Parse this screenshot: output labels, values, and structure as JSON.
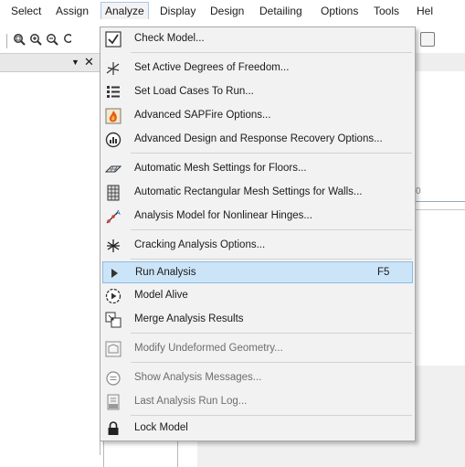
{
  "menubar": {
    "items": [
      {
        "label": "Select"
      },
      {
        "label": "Assign"
      },
      {
        "label": "Analyze"
      },
      {
        "label": "Display"
      },
      {
        "label": "Design"
      },
      {
        "label": "Detailing"
      },
      {
        "label": "Options"
      },
      {
        "label": "Tools"
      },
      {
        "label": "Hel"
      }
    ],
    "active": "Analyze"
  },
  "toolbar": {
    "icons": [
      "zoom-window-icon",
      "zoom-in-icon",
      "zoom-out-icon",
      "zoom-extents-icon"
    ]
  },
  "panel": {
    "collapse_glyph": "▼",
    "close_glyph": "✕"
  },
  "analyze_menu": {
    "colors": {
      "highlight_bg": "#cce4f7",
      "highlight_border": "#8cbbe4",
      "menu_bg": "#f2f2f2",
      "disabled_text": "#6d6d6d"
    },
    "items": [
      {
        "label": "Check Model...",
        "icon": "check-icon",
        "enabled": true
      },
      {
        "label": "Set Active Degrees of Freedom...",
        "icon": "degrees-of-freedom-icon",
        "enabled": true
      },
      {
        "label": "Set Load Cases To Run...",
        "icon": "load-cases-icon",
        "enabled": true
      },
      {
        "label": "Advanced SAPFire Options...",
        "icon": "sapfire-icon",
        "enabled": true
      },
      {
        "label": "Advanced Design and Response Recovery Options...",
        "icon": "response-recovery-icon",
        "enabled": true
      },
      {
        "label": "Automatic Mesh Settings for Floors...",
        "icon": "floor-mesh-icon",
        "enabled": true
      },
      {
        "label": "Automatic Rectangular Mesh Settings for Walls...",
        "icon": "wall-mesh-icon",
        "enabled": true
      },
      {
        "label": "Analysis Model for Nonlinear Hinges...",
        "icon": "nonlinear-hinges-icon",
        "enabled": true
      },
      {
        "label": "Cracking Analysis Options...",
        "icon": "cracking-icon",
        "enabled": true
      },
      {
        "label": "Run Analysis",
        "icon": "run-analysis-icon",
        "shortcut": "F5",
        "enabled": true,
        "highlighted": true
      },
      {
        "label": "Model Alive",
        "icon": "model-alive-icon",
        "enabled": true
      },
      {
        "label": "Merge Analysis Results",
        "icon": "merge-results-icon",
        "enabled": true
      },
      {
        "label": "Modify Undeformed Geometry...",
        "icon": "undeformed-geometry-icon",
        "enabled": false
      },
      {
        "label": "Show Analysis Messages...",
        "icon": "messages-icon",
        "enabled": false
      },
      {
        "label": "Last Analysis Run Log...",
        "icon": "run-log-icon",
        "enabled": false
      },
      {
        "label": "Lock Model",
        "icon": "lock-icon",
        "enabled": true
      }
    ]
  },
  "background": {
    "field_digit": "0"
  }
}
